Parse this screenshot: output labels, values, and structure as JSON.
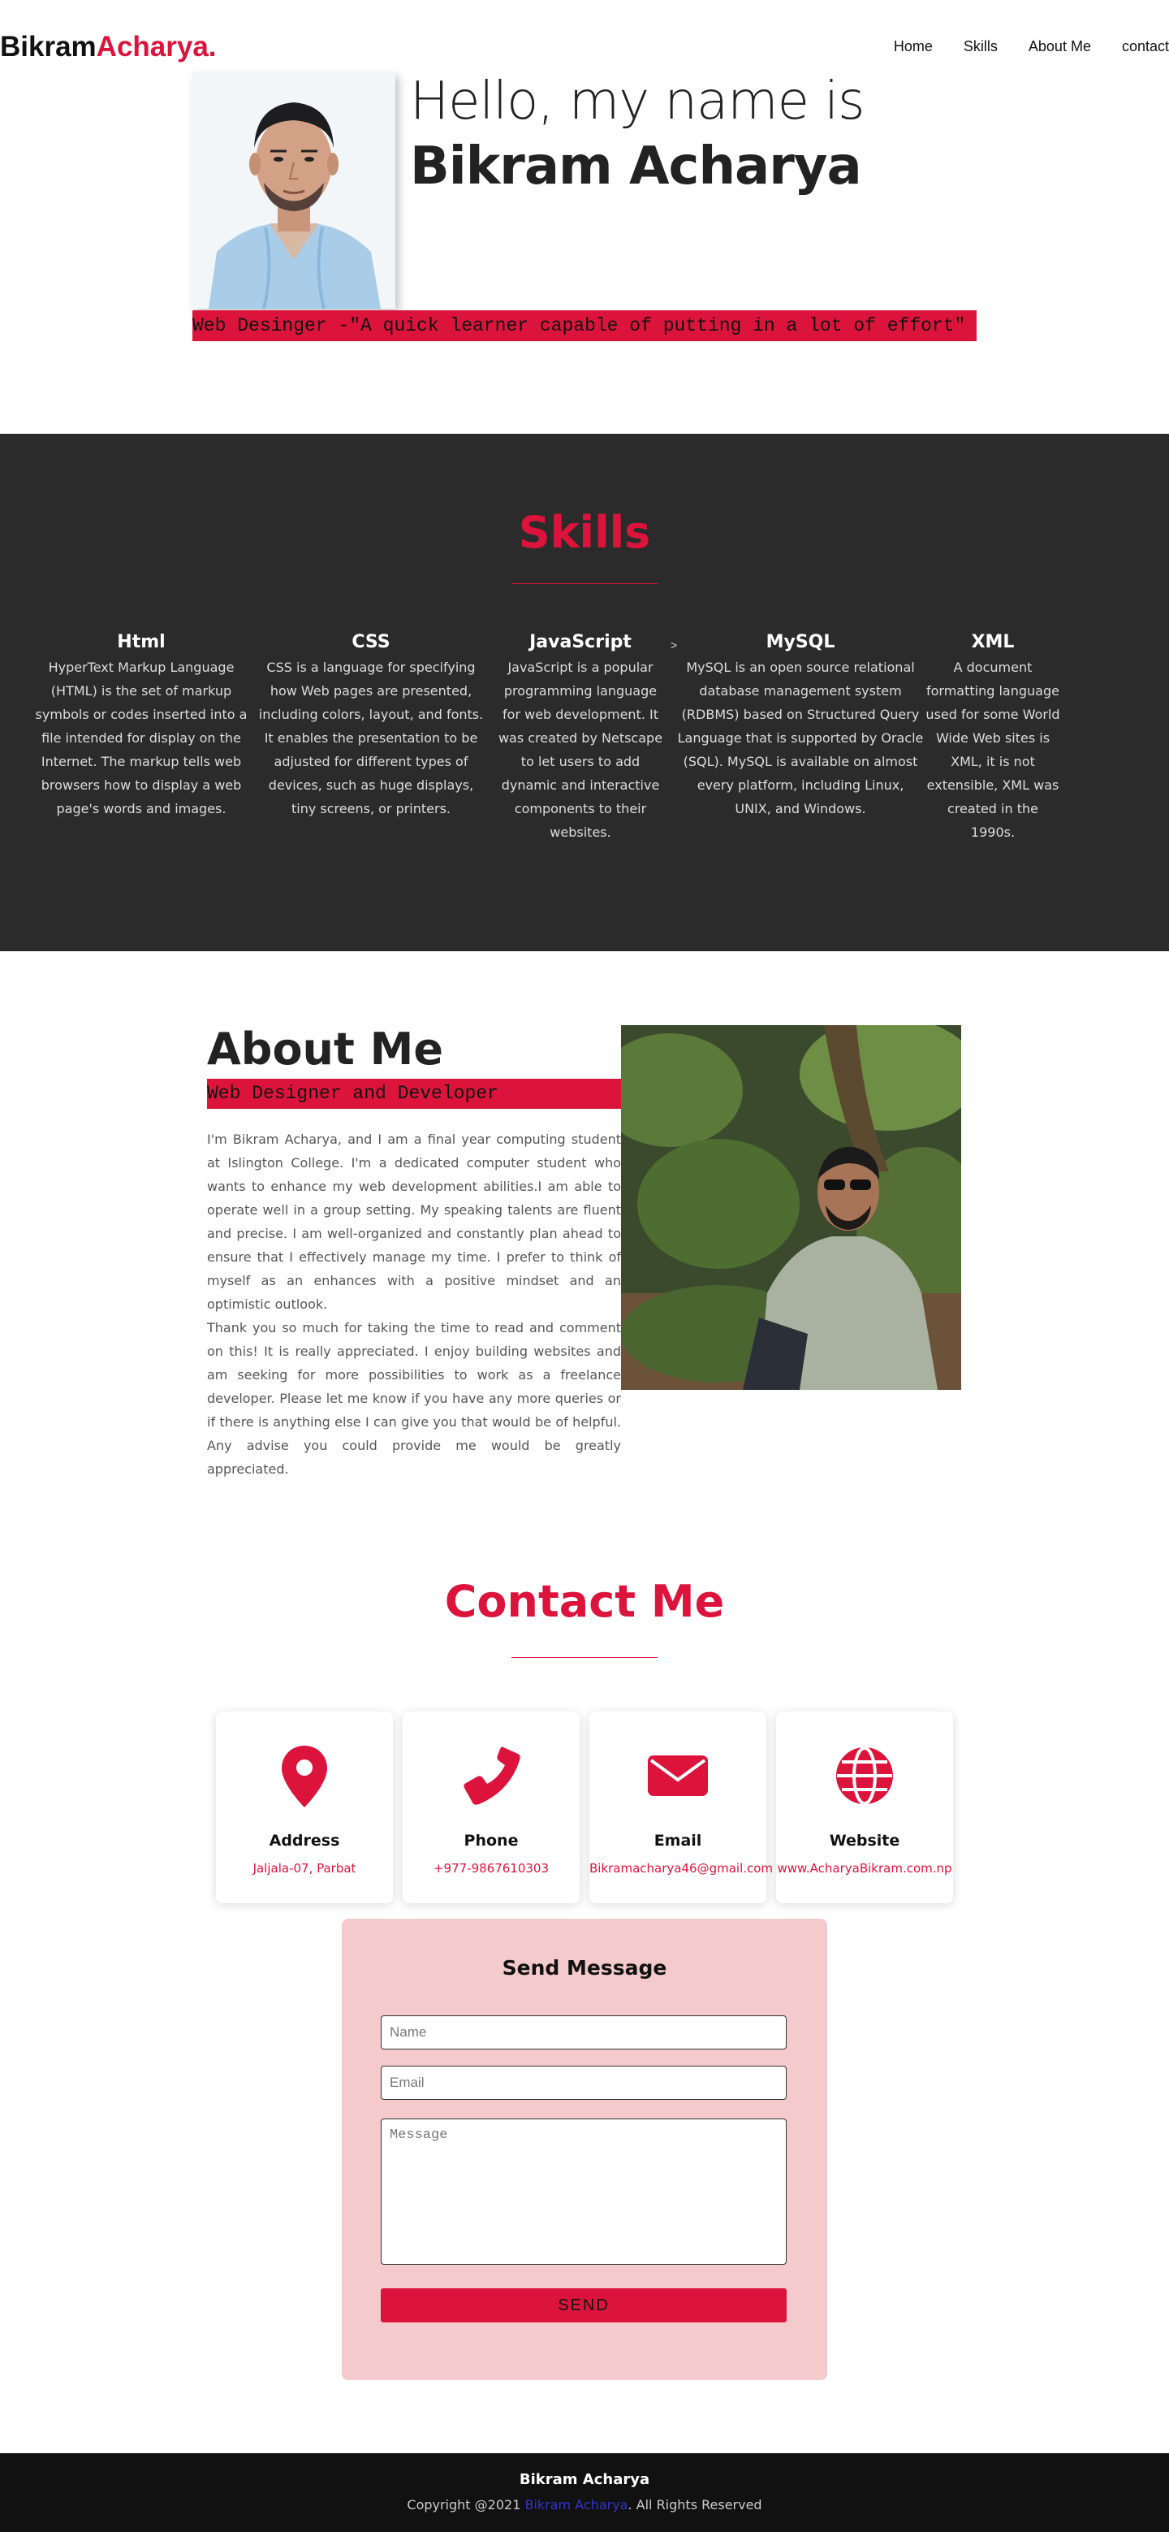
{
  "nav": {
    "logo_first": "Bikram",
    "logo_second": "Acharya.",
    "links": [
      "Home",
      "Skills",
      "About Me",
      "contact"
    ]
  },
  "hero": {
    "greeting": "Hello, my name is",
    "name": "Bikram Acharya",
    "tagline": "Web Desinger -\"A quick learner capable of putting in a lot of effort\""
  },
  "skills": {
    "title": "Skills",
    "items": [
      {
        "name": "Html",
        "desc": "HyperText Markup Language (HTML) is the set of markup symbols or codes inserted into a file intended for display on the Internet. The markup tells web browsers how to display a web page's words and images."
      },
      {
        "name": "CSS",
        "desc": "CSS is a language for specifying how Web pages are presented, including colors, layout, and fonts. It enables the presentation to be adjusted for different types of devices, such as huge displays, tiny screens, or printers."
      },
      {
        "name": "JavaScript",
        "desc": "JavaScript is a popular programming language for web development. It was created by Netscape to let users to add dynamic and interactive components to their websites."
      },
      {
        "name": "MySQL",
        "desc": "MySQL is an open source relational database management system (RDBMS) based on Structured Query Language that is supported by Oracle (SQL). MySQL is available on almost every platform, including Linux, UNIX, and Windows."
      },
      {
        "name": "XML",
        "desc": "A document formatting language used for some World Wide Web sites is XML, it is not extensible, XML was created in the 1990s."
      }
    ],
    "arrow": ">"
  },
  "about": {
    "title": "About Me",
    "subtitle": "Web Designer and Developer",
    "para1": "I'm Bikram Acharya, and  I am a final year computing student at Islington College. I'm a dedicated computer student who wants to enhance my web development abilities.I am able to operate well in a group setting. My speaking talents are fluent and precise. I am well-organized and constantly plan ahead to ensure that I effectively manage my time. I prefer to think of myself as an enhances with a positive mindset and an optimistic outlook.",
    "para2": "Thank you so much for taking the time to read and comment on this! It is really appreciated. I enjoy building websites and am seeking for more possibilities to work as a freelance developer. Please let me know if you have any more queries or if there is anything else I can  give you that would be of helpful.  Any advise you could provide me would be greatly appreciated."
  },
  "contact": {
    "title": "Contact Me",
    "cards": [
      {
        "label": "Address",
        "value": "Jaljala-07, Parbat",
        "icon": "map-pin-icon"
      },
      {
        "label": "Phone",
        "value": "+977-9867610303",
        "icon": "phone-icon"
      },
      {
        "label": "Email",
        "value": "Bikramacharya46@gmail.com",
        "icon": "envelope-icon"
      },
      {
        "label": "Website",
        "value": "www.AcharyaBikram.com.np",
        "icon": "globe-icon"
      }
    ],
    "form": {
      "title": "Send Message",
      "name_placeholder": "Name",
      "email_placeholder": "Email",
      "message_placeholder": "Message",
      "send_label": "SEND"
    }
  },
  "footer": {
    "name": "Bikram Acharya",
    "copy_prefix": "Copyright @2021 ",
    "copy_link": "Bikram Acharya",
    "copy_suffix": ". All Rights Reserved"
  },
  "colors": {
    "accent": "#dc143c",
    "dark": "#2b2b2b",
    "form_bg": "#f5cacc"
  }
}
